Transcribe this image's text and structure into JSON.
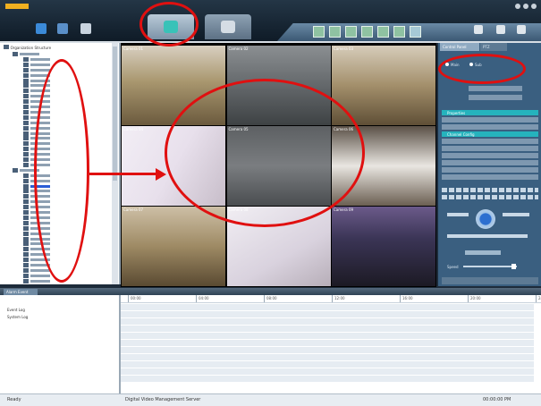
{
  "app": {
    "logo": "",
    "status_left": "Ready",
    "status_mid": "Digital Video Management Server",
    "status_right": "00:00:00 PM"
  },
  "toolbar": {
    "icons": [
      "device-icon",
      "config-icon",
      "playback-icon"
    ]
  },
  "tabs": [
    {
      "name": "preview-tab",
      "active": true
    },
    {
      "name": "playback-tab",
      "active": false
    }
  ],
  "view_buttons": [
    "1x1",
    "2x2",
    "3x3",
    "4x4",
    "5x5",
    "6x6",
    "custom"
  ],
  "device_tree": {
    "root": "Organization Structure",
    "selected_index": 25
  },
  "video_cells": [
    {
      "label": "Camera 01"
    },
    {
      "label": "Camera 02"
    },
    {
      "label": "Camera 03"
    },
    {
      "label": "Camera 04"
    },
    {
      "label": "Camera 05"
    },
    {
      "label": "Camera 06"
    },
    {
      "label": "Camera 07"
    },
    {
      "label": "Camera 08"
    },
    {
      "label": "Camera 09"
    }
  ],
  "right_panel": {
    "tab1": "Control Panel",
    "tab2": "PTZ",
    "stream_main": "Main",
    "stream_sub": "Sub",
    "section_info": "Properties",
    "section_config": "Channel Config",
    "speed_label": "Speed"
  },
  "bottom": {
    "tab": "Alarm Event",
    "log1": "Event Log",
    "log2": "System Log",
    "ruler_labels": [
      "00:00",
      "04:00",
      "08:00",
      "12:00",
      "16:00",
      "20:00",
      "24:00"
    ]
  },
  "colors": {
    "highlight": "#e01010",
    "accent": "#25b3bd",
    "brand": "#f0b020"
  }
}
